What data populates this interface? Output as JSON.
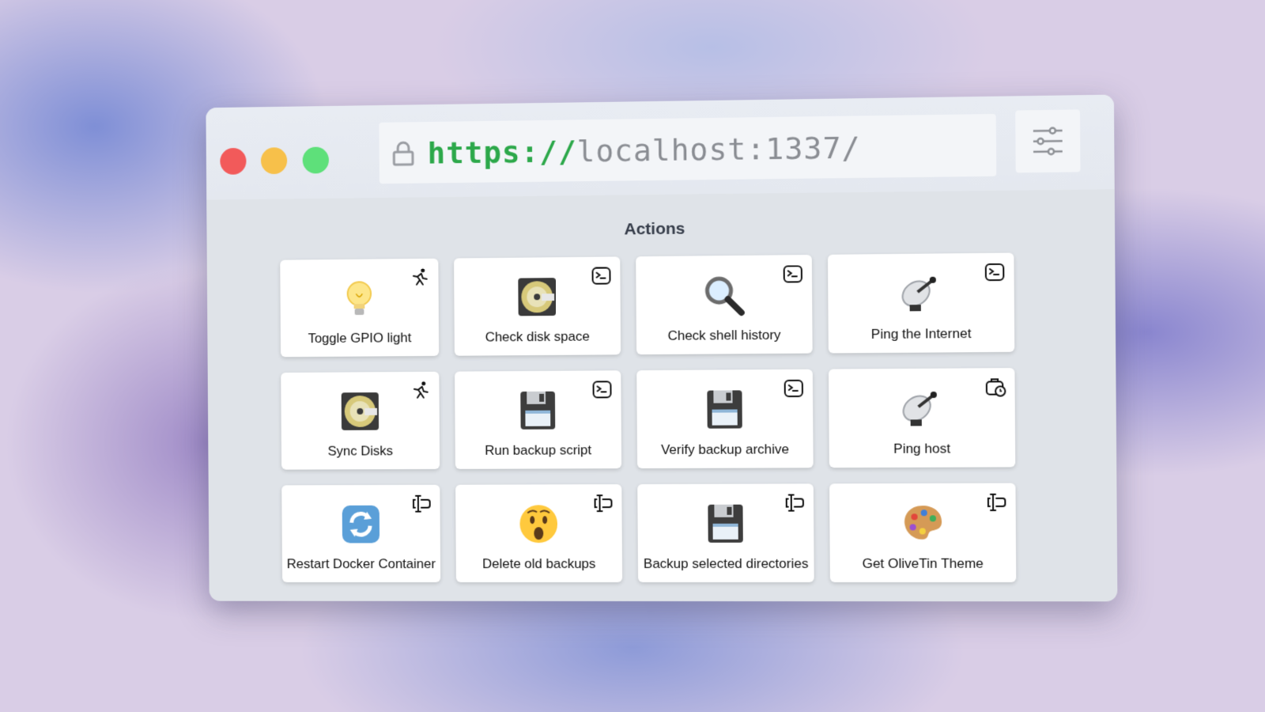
{
  "browser": {
    "url_scheme": "https://",
    "url_host": "localhost:1337/"
  },
  "section": {
    "title": "Actions"
  },
  "actions": [
    {
      "label": "Toggle GPIO light",
      "icon": "lightbulb-icon",
      "mode": "run-icon"
    },
    {
      "label": "Check disk space",
      "icon": "disc-icon",
      "mode": "terminal-icon"
    },
    {
      "label": "Check shell history",
      "icon": "magnifier-icon",
      "mode": "terminal-icon"
    },
    {
      "label": "Ping the Internet",
      "icon": "satellite-dish-icon",
      "mode": "terminal-icon"
    },
    {
      "label": "Sync Disks",
      "icon": "disc-icon",
      "mode": "run-icon"
    },
    {
      "label": "Run backup script",
      "icon": "floppy-disk-icon",
      "mode": "terminal-icon"
    },
    {
      "label": "Verify backup archive",
      "icon": "floppy-disk-icon",
      "mode": "terminal-icon"
    },
    {
      "label": "Ping host",
      "icon": "satellite-dish-icon",
      "mode": "timed-icon"
    },
    {
      "label": "Restart Docker Container",
      "icon": "refresh-icon",
      "mode": "input-icon"
    },
    {
      "label": "Delete old backups",
      "icon": "surprised-face-icon",
      "mode": "input-icon"
    },
    {
      "label": "Backup selected directories",
      "icon": "floppy-disk-icon",
      "mode": "input-icon"
    },
    {
      "label": "Get OliveTin Theme",
      "icon": "palette-icon",
      "mode": "input-icon"
    }
  ]
}
